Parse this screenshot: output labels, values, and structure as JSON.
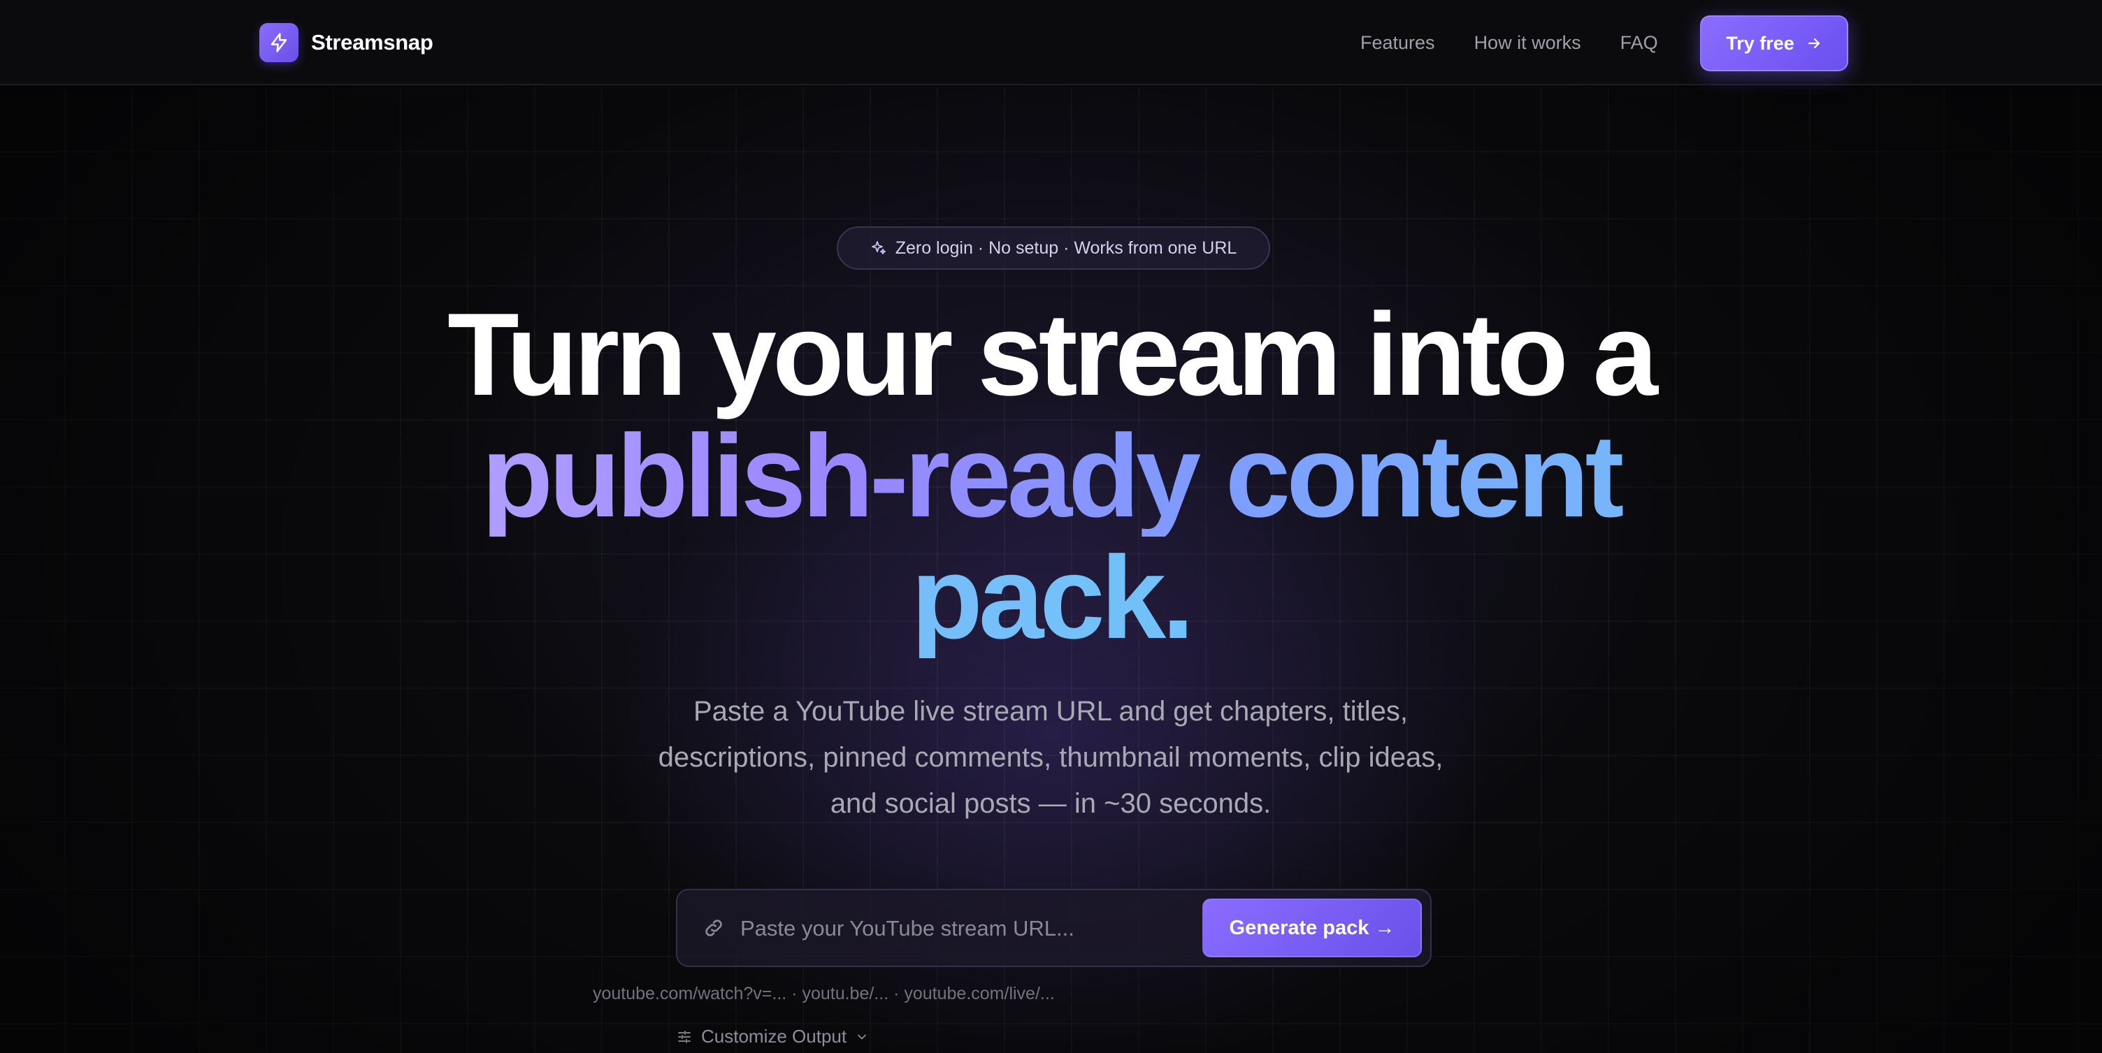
{
  "brand": {
    "name": "Streamsnap",
    "logo_icon": "lightning-bolt-icon"
  },
  "nav": {
    "links": [
      "Features",
      "How it works",
      "FAQ"
    ],
    "cta_label": "Try free",
    "cta_icon": "arrow-right-icon"
  },
  "hero": {
    "badge_icon": "sparkles-icon",
    "badge_text": "Zero login · No setup · Works from one URL",
    "headline_line1": "Turn your stream into a",
    "headline_line2": "publish-ready content",
    "headline_line3": "pack.",
    "subtitle": "Paste a YouTube live stream URL and get chapters, titles, descriptions, pinned comments, thumbnail moments, clip ideas, and social posts — in ~30 seconds."
  },
  "url_form": {
    "input_icon": "link-icon",
    "placeholder": "Paste your YouTube stream URL...",
    "value": "",
    "submit_label": "Generate pack →",
    "examples": "youtube.com/watch?v=... · youtu.be/... · youtube.com/live/..."
  },
  "customize": {
    "icon": "sliders-icon",
    "label": "Customize Output",
    "chevron_icon": "chevron-down-icon"
  },
  "colors": {
    "accent": "#7b5cff",
    "gradient_start": "#b9a6ff",
    "gradient_end": "#69c8f3",
    "background": "#0b0b0e"
  }
}
